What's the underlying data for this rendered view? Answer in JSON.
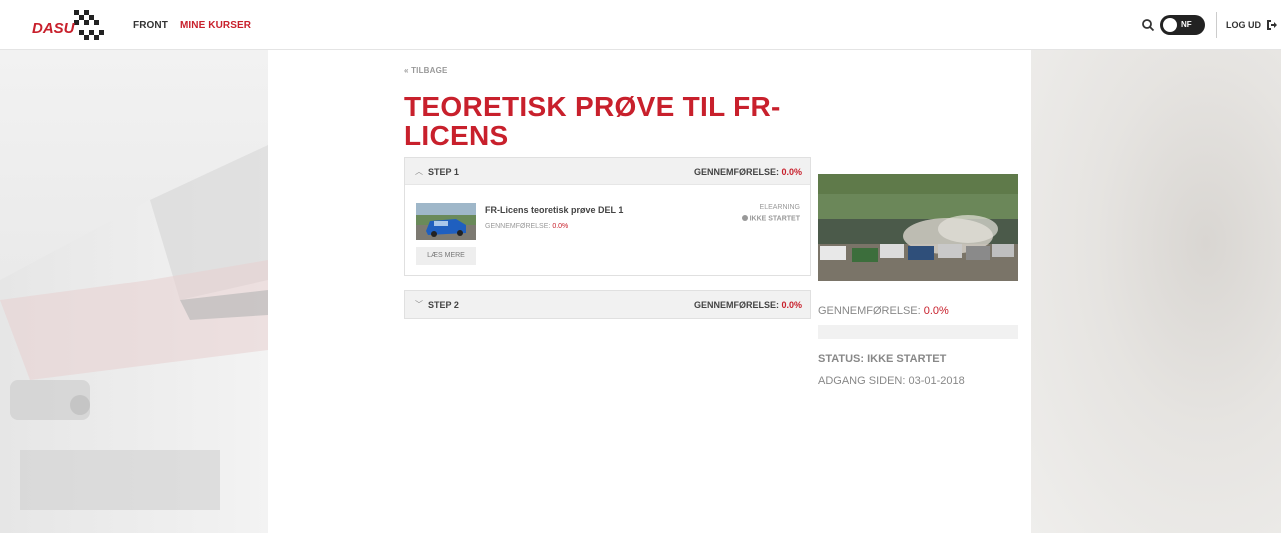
{
  "nav": {
    "logo": "DASU",
    "front": "FRONT",
    "mine_kurser": "MINE KURSER",
    "toggle_label": "NF",
    "logout": "LOG UD"
  },
  "page": {
    "back": "« TILBAGE",
    "title": "TEORETISK PRØVE TIL FR-LICENS"
  },
  "steps": [
    {
      "title": "STEP 1",
      "progress_label": "GENNEMFØRELSE:",
      "progress_value": "0.0%",
      "expanded": true,
      "courses": [
        {
          "name": "FR-Licens teoretisk prøve DEL 1",
          "progress_label": "GENNEMFØRELSE:",
          "progress_value": "0.0%",
          "type": "ELEARNING",
          "status": "IKKE STARTET",
          "button": "LÆS MERE"
        }
      ]
    },
    {
      "title": "STEP 2",
      "progress_label": "GENNEMFØRELSE:",
      "progress_value": "0.0%",
      "expanded": false
    }
  ],
  "sidebar": {
    "progress_label": "GENNEMFØRELSE:",
    "progress_value": "0.0%",
    "progress_fraction": 0.0,
    "status": "STATUS: IKKE STARTET",
    "since": "ADGANG SIDEN: 03-01-2018"
  },
  "colors": {
    "accent": "#c8202c",
    "text_muted": "#888888",
    "panel_bg": "#f1f1f1"
  },
  "icons": {
    "search": "search-icon",
    "logout": "logout-icon",
    "step1_chevron": "chevron-up-icon",
    "step2_chevron": "chevron-down-icon"
  }
}
